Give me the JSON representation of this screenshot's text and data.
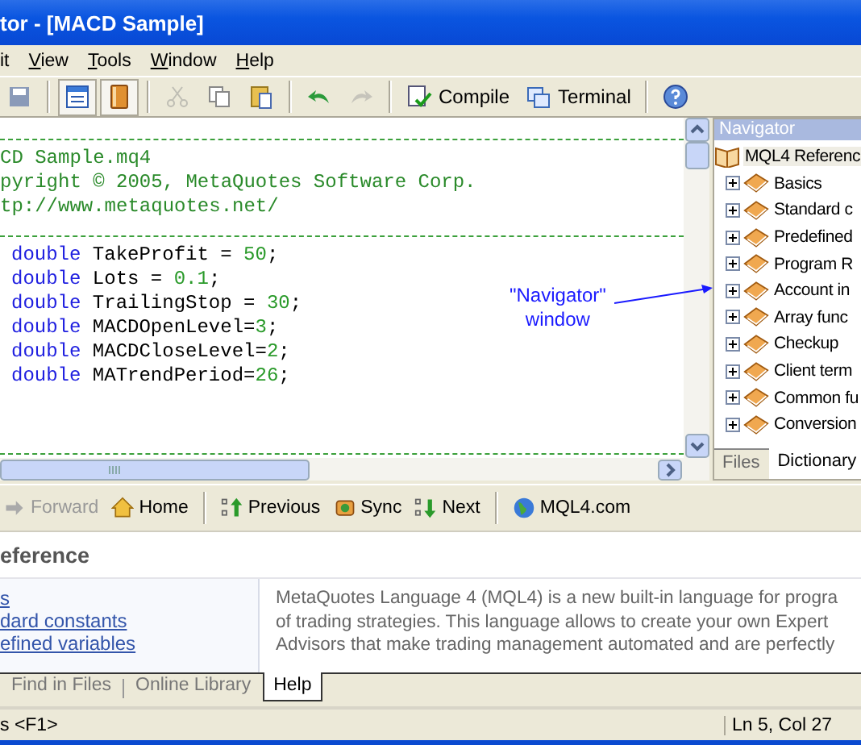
{
  "window": {
    "title": "tor - [MACD Sample]"
  },
  "menu": [
    {
      "label": "it",
      "mnemonic": false
    },
    {
      "label": "View",
      "mnemonic": true
    },
    {
      "label": "Tools",
      "mnemonic": true
    },
    {
      "label": "Window",
      "mnemonic": true
    },
    {
      "label": "Help",
      "mnemonic": true
    }
  ],
  "toolbar": [
    {
      "pressed": false,
      "disabled": false
    },
    {
      "pressed": true,
      "disabled": false
    },
    {
      "pressed": true,
      "disabled": false
    },
    {
      "pressed": false,
      "disabled": true
    },
    {
      "pressed": false,
      "disabled": false
    },
    {
      "pressed": false,
      "disabled": false
    },
    {
      "pressed": false,
      "disabled": false
    },
    {
      "pressed": false,
      "disabled": true
    },
    {
      "label": "Compile",
      "pressed": false,
      "disabled": false
    },
    {
      "label": "Terminal",
      "pressed": false,
      "disabled": false
    },
    {
      "pressed": false,
      "disabled": false
    }
  ],
  "editor": {
    "lines": [
      {
        "kind": "rule"
      },
      {
        "kind": "comment",
        "text": "CD Sample.mq4"
      },
      {
        "kind": "comment",
        "text": "pyright © 2005, MetaQuotes Software Corp."
      },
      {
        "kind": "comment",
        "text": "tp://www.metaquotes.net/"
      },
      {
        "kind": "rule"
      },
      {
        "kind": "code",
        "keyword": "double",
        "text": "TakeProfit = ",
        "number": "50",
        "end": ";"
      },
      {
        "kind": "code",
        "keyword": "double",
        "text": "Lots = ",
        "number": "0.1",
        "end": ";"
      },
      {
        "kind": "code",
        "keyword": "double",
        "text": "TrailingStop = ",
        "number": "30",
        "end": ";"
      },
      {
        "kind": "code",
        "keyword": "double",
        "text": "MACDOpenLevel=",
        "number": "3",
        "end": ";"
      },
      {
        "kind": "code",
        "keyword": "double",
        "text": "MACDCloseLevel=",
        "number": "2",
        "end": ";"
      },
      {
        "kind": "code",
        "keyword": "double",
        "text": "MATrendPeriod=",
        "number": "26",
        "end": ";"
      },
      {
        "kind": "blank"
      },
      {
        "kind": "blank"
      },
      {
        "kind": "rule"
      }
    ]
  },
  "annotation": {
    "lines": [
      "\"Navigator\"",
      "window"
    ]
  },
  "navigator": {
    "title": "Navigator",
    "root": {
      "label": "MQL4 Referenc",
      "selected": true,
      "children": [
        {
          "label": "Basics",
          "expanded": false,
          "selected": false
        },
        {
          "label": "Standard c",
          "expanded": false,
          "selected": false
        },
        {
          "label": "Predefined",
          "expanded": false,
          "selected": false
        },
        {
          "label": "Program R",
          "expanded": false,
          "selected": false
        },
        {
          "label": "Account in",
          "expanded": false,
          "selected": false
        },
        {
          "label": "Array func",
          "expanded": false,
          "selected": false
        },
        {
          "label": "Checkup",
          "expanded": false,
          "selected": false
        },
        {
          "label": "Client term",
          "expanded": false,
          "selected": false
        },
        {
          "label": "Common fu",
          "expanded": false,
          "selected": false
        },
        {
          "label": "Conversion",
          "expanded": false,
          "selected": false
        }
      ]
    },
    "tabs": [
      {
        "label": "Files",
        "selected": false
      },
      {
        "label": "Dictionary",
        "selected": true
      }
    ]
  },
  "help_toolbar": [
    {
      "label": "Forward",
      "disabled": true
    },
    {
      "label": "Home",
      "disabled": false
    },
    {
      "label": "Previous",
      "disabled": false
    },
    {
      "label": "Sync",
      "disabled": false
    },
    {
      "label": "Next",
      "disabled": false
    },
    {
      "label": "MQL4.com",
      "disabled": false
    }
  ],
  "help": {
    "heading": "eference",
    "links": [
      "s",
      "dard constants",
      "efined variables"
    ],
    "paragraph_lines": [
      "MetaQuotes Language 4 (MQL4) is a new built-in language for progra",
      "of trading strategies. This language allows to create your own Expert",
      "Advisors that make trading management automated and are perfectly"
    ]
  },
  "bottom_tabs": [
    {
      "label": "Find in Files",
      "selected": false
    },
    {
      "label": "Online Library",
      "selected": false
    },
    {
      "label": "Help",
      "selected": true
    }
  ],
  "status_bar": {
    "hint": "s <F1>",
    "position": "Ln 5, Col 27"
  }
}
